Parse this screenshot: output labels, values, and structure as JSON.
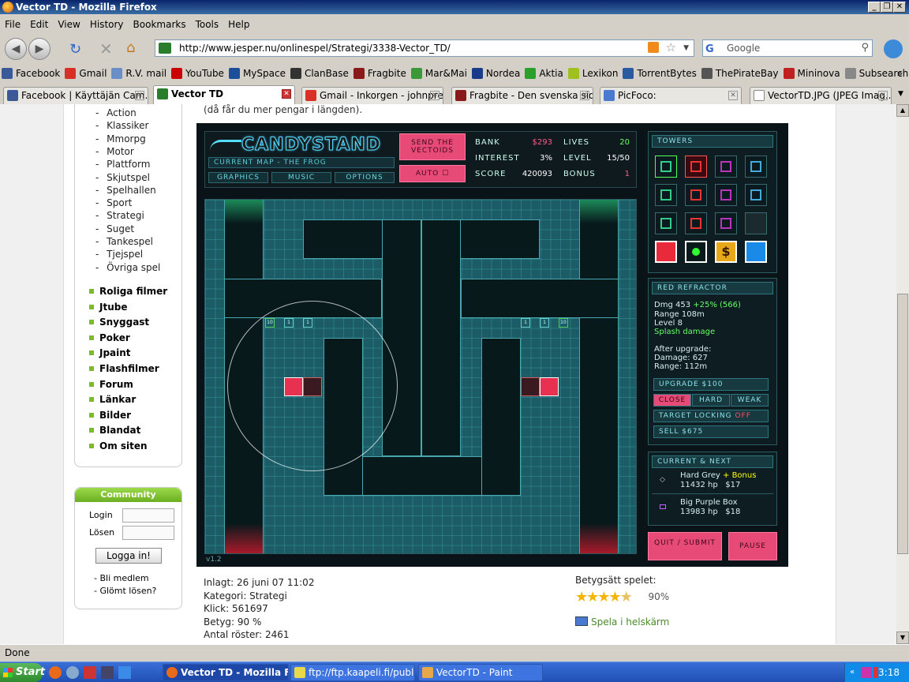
{
  "window": {
    "title": "Vector TD - Mozilla Firefox"
  },
  "menu": [
    "File",
    "Edit",
    "View",
    "History",
    "Bookmarks",
    "Tools",
    "Help"
  ],
  "nav": {
    "url": "http://www.jesper.nu/onlinespel/Strategi/3338-Vector_TD/",
    "search_placeholder": "Google"
  },
  "bookmarks": [
    {
      "label": "Facebook",
      "color": "#3b5998"
    },
    {
      "label": "Gmail",
      "color": "#d93025"
    },
    {
      "label": "R.V. mail",
      "color": "#6a8fc8"
    },
    {
      "label": "YouTube",
      "color": "#cc0000"
    },
    {
      "label": "MySpace",
      "color": "#1d4e9b"
    },
    {
      "label": "ClanBase",
      "color": "#333333"
    },
    {
      "label": "Fragbite",
      "color": "#8a1a1a"
    },
    {
      "label": "Mar&Mai",
      "color": "#3a9a3a"
    },
    {
      "label": "Nordea",
      "color": "#1a3a8a"
    },
    {
      "label": "Aktia",
      "color": "#2aa02a"
    },
    {
      "label": "Lexikon",
      "color": "#a0c020"
    },
    {
      "label": "TorrentBytes",
      "color": "#2a5aa0"
    },
    {
      "label": "ThePirateBay",
      "color": "#555555"
    },
    {
      "label": "Mininova",
      "color": "#c02020"
    },
    {
      "label": "Subsearch",
      "color": "#888888"
    }
  ],
  "tabs": [
    {
      "label": "Facebook | Käyttäjän Cam...",
      "active": false
    },
    {
      "label": "Vector TD",
      "active": true
    },
    {
      "label": "Gmail - Inkorgen - johnpre...",
      "active": false
    },
    {
      "label": "Fragbite - Den svenska sid...",
      "active": false
    },
    {
      "label": "PicFoco:",
      "active": false
    },
    {
      "label": "VectorTD.JPG (JPEG Imag...",
      "active": false
    }
  ],
  "intro_text": "(då får du mer pengar i längden).",
  "sidebar": {
    "subcategories": [
      "Action",
      "Klassiker",
      "Mmorpg",
      "Motor",
      "Plattform",
      "Skjutspel",
      "Spelhallen",
      "Sport",
      "Strategi",
      "Suget",
      "Tankespel",
      "Tjejspel",
      "Övriga spel"
    ],
    "categories": [
      "Roliga filmer",
      "Jtube",
      "Snyggast",
      "Poker",
      "Jpaint",
      "Flashfilmer",
      "Forum",
      "Länkar",
      "Bilder",
      "Blandat",
      "Om siten"
    ]
  },
  "community": {
    "title": "Community",
    "login_label": "Login",
    "password_label": "Lösen",
    "login_button": "Logga in!",
    "register": "- Bli medlem",
    "forgot": "- Glömt lösen?"
  },
  "game": {
    "logo": "CANDYSTAND",
    "current_map": "CURRENT MAP - THE FROG",
    "graphics": "GRAPHICS",
    "music": "MUSIC",
    "options": "OPTIONS",
    "send_vectoids": "SEND THE VECTOIDS",
    "auto": "AUTO",
    "bank_label": "BANK",
    "bank": "$293",
    "lives_label": "LIVES",
    "lives": "20",
    "interest_label": "INTEREST",
    "interest": "3%",
    "level_label": "LEVEL",
    "level": "15/50",
    "score_label": "SCORE",
    "score": "420093",
    "bonus_label": "BONUS",
    "bonus": "1",
    "version": "v1.2",
    "towers_title": "TOWERS",
    "tower_dollar": "$",
    "selected": {
      "title": "RED REFRACTOR",
      "dmg": "Dmg 453",
      "dmg_up": "+25% (566)",
      "range": "Range 108m",
      "level": "Level 8",
      "splash": "Splash damage",
      "after": "After upgrade:",
      "after_dmg": "Damage: 627",
      "after_range": "Range: 112m",
      "upgrade": "UPGRADE $100",
      "close": "CLOSE",
      "hard": "HARD",
      "weak": "WEAK",
      "target": "TARGET LOCKING",
      "target_state": "OFF",
      "sell": "SELL $675"
    },
    "next_title": "CURRENT & NEXT",
    "next": [
      {
        "name": "Hard Grey",
        "bonus": "+ Bonus",
        "hp": "11432 hp",
        "price": "$17"
      },
      {
        "name": "Big Purple Box",
        "bonus": "",
        "hp": "13983 hp",
        "price": "$18"
      }
    ],
    "quit": "QUIT / SUBMIT",
    "pause": "PAUSE",
    "tower_levels": [
      "10",
      "1",
      "1",
      "1",
      "1",
      "10"
    ]
  },
  "info": {
    "lines": [
      "Inlagt: 26 juni 07 11:02",
      "Kategori: Strategi",
      "Klick: 561697",
      "Betyg: 90 %",
      "Antal röster: 2461"
    ]
  },
  "rating": {
    "label": "Betygsätt spelet:",
    "percent": "90%",
    "stars": 4.5,
    "fullscreen": "Spela i helskärm"
  },
  "status": "Done",
  "taskbar": {
    "start": "Start",
    "items": [
      "Vector TD - Mozilla Fir...",
      "ftp://ftp.kaapeli.fi/public...",
      "VectorTD - Paint"
    ],
    "time": "3:18"
  }
}
